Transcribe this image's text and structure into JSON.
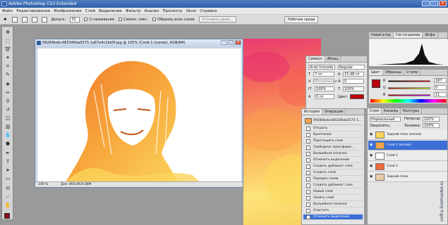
{
  "app": {
    "title": "Adobe Photoshop CS3 Extended",
    "logo_text": "Ps"
  },
  "menu": [
    "Файл",
    "Редактирование",
    "Изображение",
    "Слой",
    "Выделение",
    "Фильтр",
    "Анализ",
    "Просмотр",
    "Окно",
    "Справка"
  ],
  "options": {
    "tolerance_label": "Допуск:",
    "tolerance_value": "32",
    "antialias": "Сглаживание",
    "contiguous": "Смежн. пикс.",
    "all_layers": "Образец всех слоев",
    "refine_edge": "Уточнить край...",
    "workspace": "Рабочая среда"
  },
  "document": {
    "title": "09284bebc485346da5575 1a67e4c1bb5f.jpg @ 100% (Слой 1 (копия), RGB/8#)",
    "zoom": "100 %",
    "doc_info": "Док: 800,0K/4,08M"
  },
  "character_panel": {
    "tabs": [
      "Символ",
      "Абзац"
    ],
    "font": "Arial Unicode",
    "style": "Regular",
    "size": "7 пт",
    "leading": "15,48 пт",
    "kerning": "Метрически",
    "tracking": "0",
    "vscale": "100%",
    "hscale": "100%",
    "baseline": "0 пт",
    "color_label": "Цвет:"
  },
  "history_panel": {
    "tabs": [
      "История",
      "Операции"
    ],
    "snapshot": "09284bebc485346da5575 1...",
    "items": [
      "Открыть",
      "Кропчение",
      "Перетащить слой",
      "Свободное трансформ...",
      "Волшебная палочка",
      "Отменить выделение",
      "Создать дубликат слоя",
      "Создать слой",
      "Порядок слоев",
      "Создать дубликат слоя",
      "Новый слой",
      "Залить слой",
      "Волшебная палочка",
      "Очистить",
      "Отменить выделение"
    ],
    "active_index": 14
  },
  "navigator_panel": {
    "tabs": [
      "Навигатор",
      "Гистограмма",
      "Инфо"
    ]
  },
  "color_panel": {
    "tabs": [
      "Цвет",
      "Образцы",
      "Стили"
    ],
    "r_label": "R",
    "g_label": "G",
    "b_label": "B",
    "r": "187",
    "g": "0",
    "b": "11",
    "fg_color": "#bb000b"
  },
  "layers_panel": {
    "tabs": [
      "Слои",
      "Каналы",
      "Контуры"
    ],
    "blend_mode": "Нормальный",
    "opacity_label": "Непрозр:",
    "opacity": "100%",
    "lock_label": "Закрепить:",
    "fill_label": "Заливка:",
    "fill": "100%",
    "layers": [
      {
        "name": "Задний план (копия)",
        "active": false
      },
      {
        "name": "Слой 1 (копия)",
        "active": true
      },
      {
        "name": "Слой 1",
        "active": false
      },
      {
        "name": "Слой 2",
        "active": false
      },
      {
        "name": "Задний план",
        "active": false
      }
    ]
  },
  "watermark": "volha.livemaster.ru"
}
